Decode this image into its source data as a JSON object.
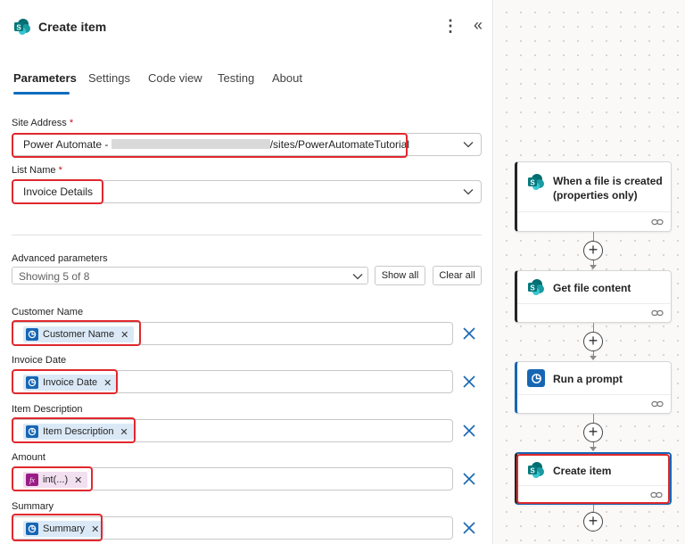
{
  "panel": {
    "title": "Create item",
    "tabs": [
      {
        "label": "Parameters",
        "active": true
      },
      {
        "label": "Settings"
      },
      {
        "label": "Code view"
      },
      {
        "label": "Testing"
      },
      {
        "label": "About"
      }
    ]
  },
  "site_address": {
    "label": "Site Address",
    "required_mark": "*",
    "value_prefix": "Power Automate - ",
    "value_suffix": "/sites/PowerAutomateTutorial"
  },
  "list_name": {
    "label": "List Name",
    "required_mark": "*",
    "value": "Invoice Details"
  },
  "advanced": {
    "label": "Advanced parameters",
    "selected": "Showing 5 of 8",
    "show_all": "Show all",
    "clear_all": "Clear all"
  },
  "params": [
    {
      "label": "Customer Name",
      "token": "Customer Name",
      "token_icon": "ai-prompt-icon"
    },
    {
      "label": "Invoice Date",
      "token": "Invoice Date",
      "token_icon": "ai-prompt-icon"
    },
    {
      "label": "Item Description",
      "token": "Item Description",
      "token_icon": "ai-prompt-icon"
    },
    {
      "label": "Amount",
      "token": "int(...)",
      "token_icon": "fx-icon"
    },
    {
      "label": "Summary",
      "token": "Summary",
      "token_icon": "ai-prompt-icon"
    }
  ],
  "flow": {
    "steps": [
      {
        "title_line1": "When a file is created",
        "title_line2": "(properties only)",
        "icon": "sharepoint-icon"
      },
      {
        "title_line1": "Get file content",
        "icon": "sharepoint-icon"
      },
      {
        "title_line1": "Run a prompt",
        "icon": "ai-prompt-icon"
      },
      {
        "title_line1": "Create item",
        "icon": "sharepoint-icon"
      }
    ],
    "add_symbol": "+"
  },
  "colors": {
    "accent": "#0f6cbd",
    "highlight": "#e0282e",
    "token_bg": "#dbe9f7",
    "ai_icon": "#1766b4",
    "fx_icon": "#9a1d86",
    "sharepoint": "#038387"
  }
}
